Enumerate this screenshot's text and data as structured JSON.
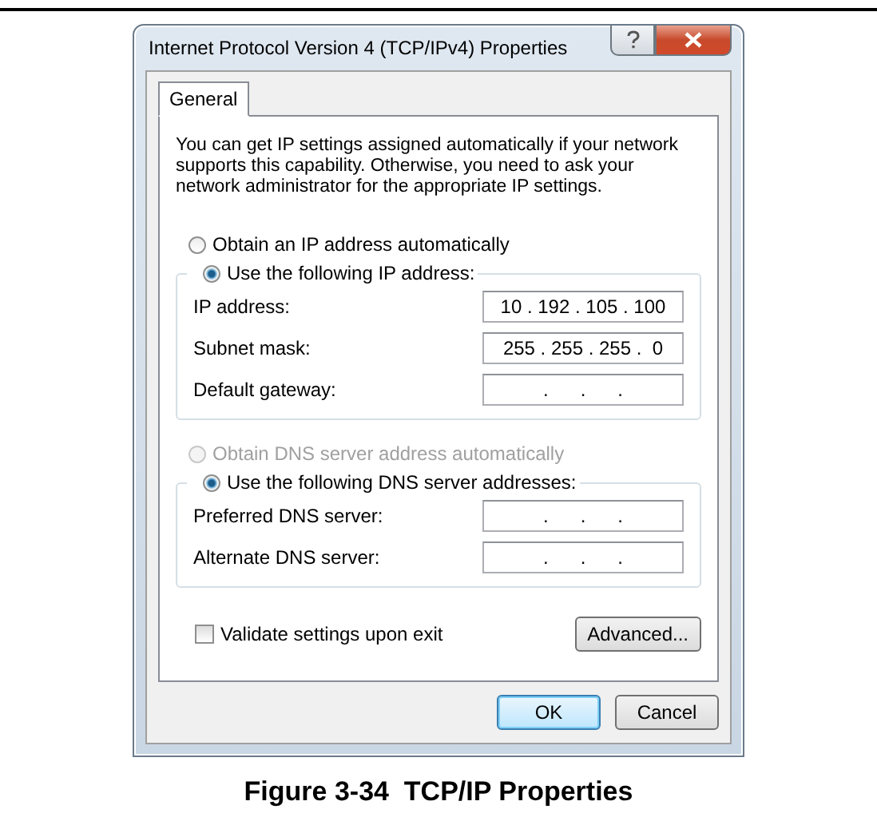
{
  "dialog": {
    "title": "Internet Protocol Version 4 (TCP/IPv4) Properties",
    "tabs": [
      {
        "label": "General",
        "selected": true
      }
    ],
    "intro": "You can get IP settings assigned automatically if your network supports this capability. Otherwise, you need to ask your network administrator for the appropriate IP settings.",
    "ip_auto": {
      "label": "Obtain an IP address automatically",
      "selected": false,
      "disabled": false
    },
    "ip_manual": {
      "label": "Use the following IP address:",
      "selected": true,
      "disabled": false
    },
    "ip_fields": [
      {
        "label": "IP address:",
        "value": "10 . 192 . 105 . 100"
      },
      {
        "label": "Subnet mask:",
        "value": "255 . 255 . 255 .  0"
      },
      {
        "label": "Default gateway:",
        "value": ".      .      ."
      }
    ],
    "dns_auto": {
      "label": "Obtain DNS server address automatically",
      "selected": false,
      "disabled": true
    },
    "dns_manual": {
      "label": "Use the following DNS server addresses:",
      "selected": true,
      "disabled": false
    },
    "dns_fields": [
      {
        "label": "Preferred DNS server:",
        "value": ".      .      ."
      },
      {
        "label": "Alternate DNS server:",
        "value": ".      .      ."
      }
    ],
    "validate": {
      "label": "Validate settings upon exit",
      "checked": false
    },
    "advanced_button": "Advanced...",
    "buttons": [
      {
        "label": "OK",
        "default": true
      },
      {
        "label": "Cancel",
        "default": false
      }
    ]
  },
  "caption": "Figure 3-34  TCP/IP Properties"
}
